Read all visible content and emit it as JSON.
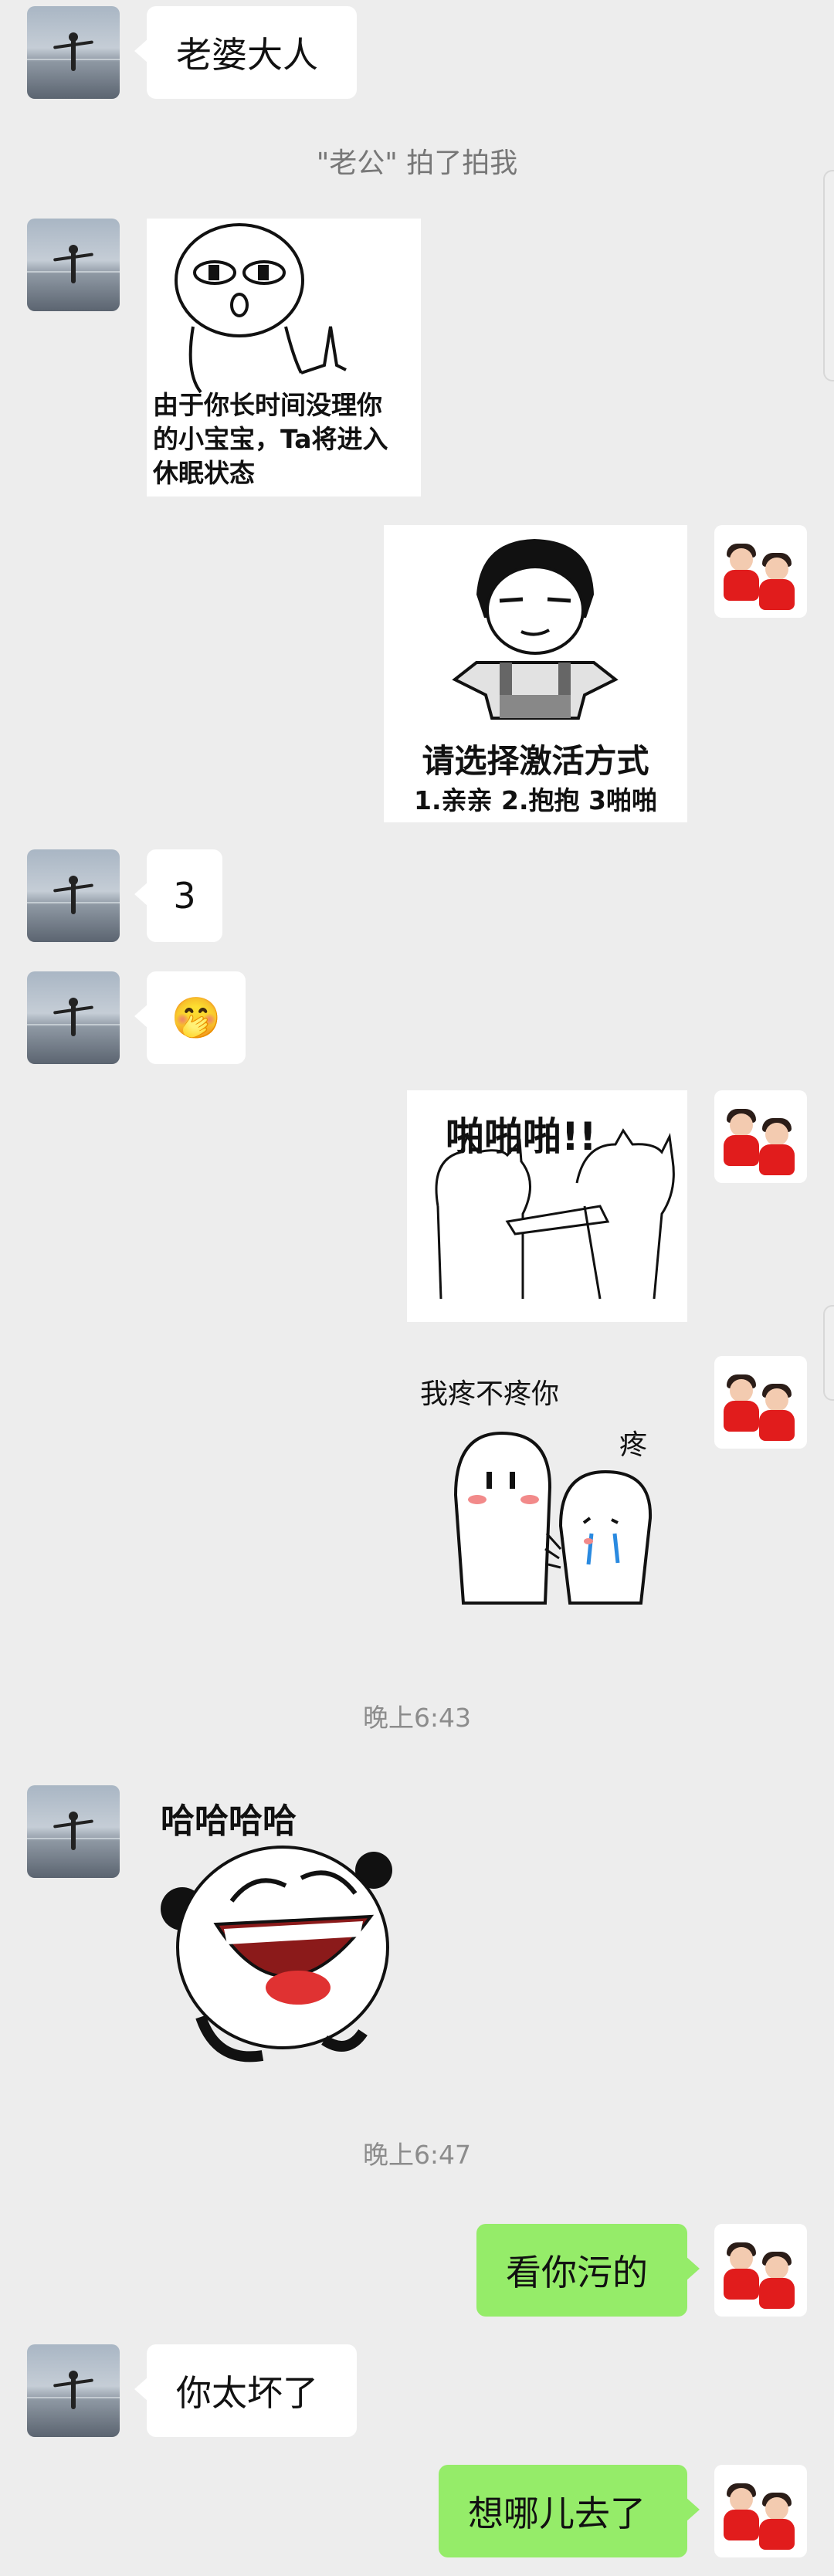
{
  "messages": {
    "m1": "老婆大人",
    "nudge": "\"老公\" 拍了拍我",
    "sticker1_caption": "由于你长时间没理你的小宝宝，Ta将进入休眠状态",
    "sticker1_line1": "由于你长时间没理你",
    "sticker1_line2": "的小宝宝，Ta将进入",
    "sticker1_line3": "休眠状态",
    "sticker2_title": "请选择激活方式",
    "sticker2_options": "1.亲亲 2.抱抱 3啪啪",
    "m3": "3",
    "emoji": "🤭",
    "sticker3_text": "啪啪啪!!",
    "sticker4_text1": "我疼不疼你",
    "sticker4_text2": "疼",
    "time1": "晚上6:43",
    "sticker5_text": "哈哈哈哈",
    "time2": "晚上6:47",
    "m4": "看你污的",
    "m5": "你太坏了",
    "m6": "想哪儿去了"
  },
  "colors": {
    "background": "#ededed",
    "bubble_other": "#ffffff",
    "bubble_self": "#95ec69"
  },
  "icons": {
    "avatar_other": "person-at-sea-photo",
    "avatar_self": "two-kids-in-red-photo"
  }
}
